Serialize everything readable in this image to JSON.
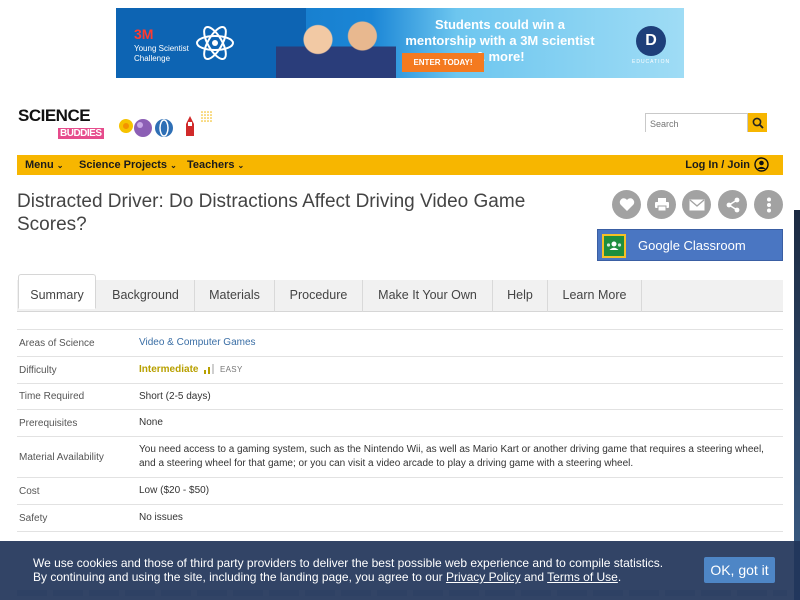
{
  "ad": {
    "brand": "3M",
    "program": "Young Scientist Challenge",
    "headline": "Students could win a mentorship with a 3M scientist & more!",
    "cta": "ENTER TODAY!",
    "partner_mark": "D",
    "partner_label": "EDUCATION"
  },
  "header": {
    "logo_line1": "SCIENCE",
    "logo_line2": "BUDDIES",
    "search_placeholder": "Search"
  },
  "nav": {
    "menu": "Menu",
    "projects": "Science Projects",
    "teachers": "Teachers",
    "login": "Log In / Join"
  },
  "page": {
    "title": "Distracted Driver: Do Distractions Affect Driving Video Game Scores?",
    "google_classroom": "Google Classroom"
  },
  "tabs": [
    {
      "label": "Summary"
    },
    {
      "label": "Background"
    },
    {
      "label": "Materials"
    },
    {
      "label": "Procedure"
    },
    {
      "label": "Make It Your Own"
    },
    {
      "label": "Help"
    },
    {
      "label": "Learn More"
    }
  ],
  "summary": {
    "areas_label": "Areas of Science",
    "areas_value": "Video & Computer Games",
    "difficulty_label": "Difficulty",
    "difficulty_value": "Intermediate",
    "difficulty_scale": "EASY",
    "time_label": "Time Required",
    "time_value": "Short (2-5 days)",
    "prereq_label": "Prerequisites",
    "prereq_value": "None",
    "material_label": "Material Availability",
    "material_value": "You need access to a gaming system, such as the Nintendo Wii, as well as Mario Kart or another driving game that requires a steering wheel, and a steering wheel for that game; or you can visit a video arcade to play a driving game with a steering wheel.",
    "cost_label": "Cost",
    "cost_value": "Low ($20 - $50)",
    "safety_label": "Safety",
    "safety_value": "No issues"
  },
  "cookie": {
    "text_part1": "We use cookies and those of third party providers to deliver the best possible web experience and to compile statistics.",
    "text_part2": "By continuing and using the site, including the landing page, you agree to our",
    "privacy_link": "Privacy Policy",
    "and": "and",
    "terms_link": "Terms of Use",
    "period": ".",
    "ok": "OK, got it"
  },
  "colors": {
    "nav_yellow": "#f7b600",
    "classroom_blue": "#4a76c2",
    "cookie_bg": "#213459",
    "link_blue": "#3a6ea5",
    "difficulty_gold": "#b8a000"
  }
}
